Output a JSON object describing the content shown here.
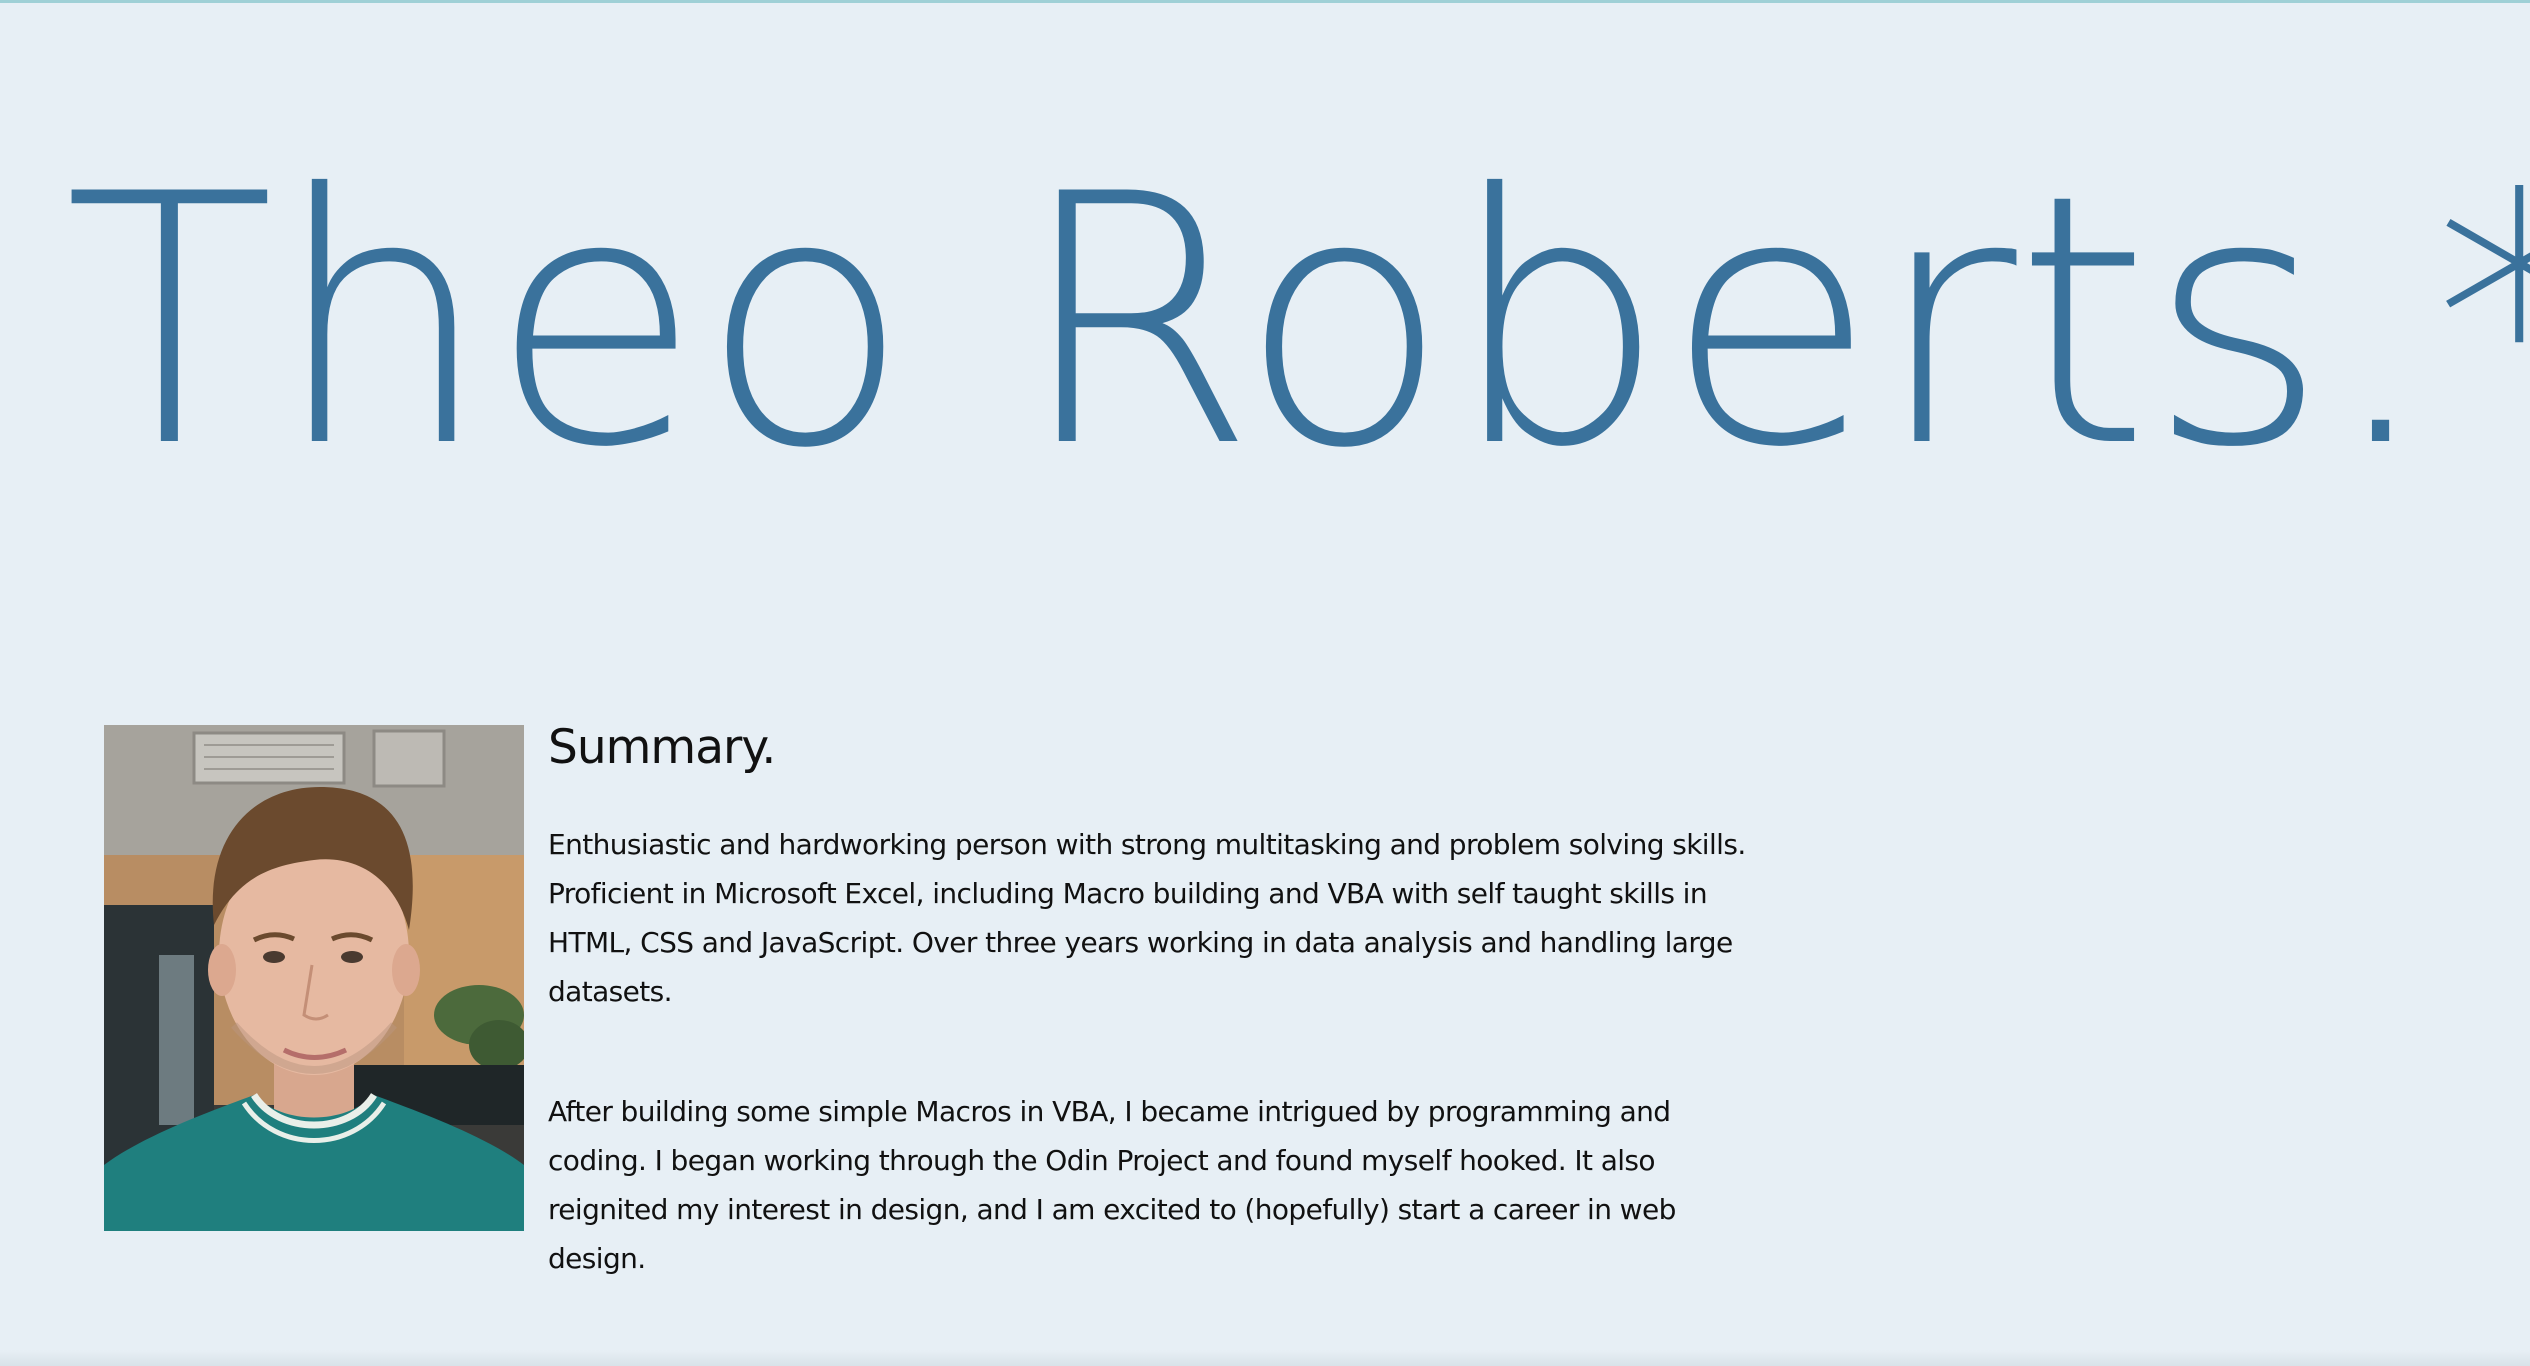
{
  "header": {
    "name": "Theo Roberts.*"
  },
  "profile": {
    "photo_icon": "portrait-photo"
  },
  "summary": {
    "heading": "Summary.",
    "paragraphs": [
      "Enthusiastic and hardworking person with strong multitasking and problem solving skills. Proficient in Microsoft Excel, including Macro building and VBA with self taught skills in HTML, CSS and JavaScript. Over three years working in data analysis and handling large datasets.",
      "After building some simple Macros in VBA, I became intrigued by programming and coding. I began working through the Odin Project and found myself hooked. It also reignited my interest in design, and I am excited to (hopefully) start a career in web design."
    ]
  },
  "colors": {
    "background": "#e7eff5",
    "accent": "#3a729c",
    "text": "#111111"
  }
}
